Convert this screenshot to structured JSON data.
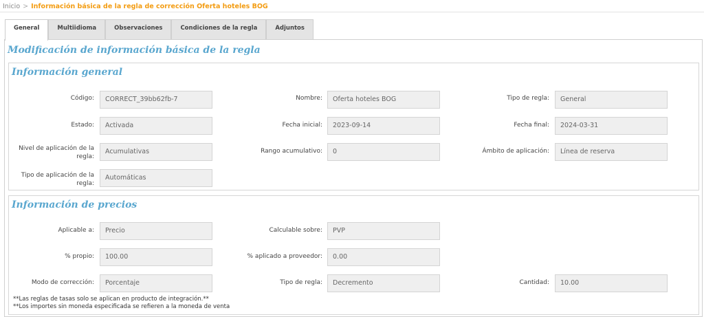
{
  "breadcrumb": {
    "home": "Inicio",
    "separator": ">",
    "current": "Información básica de la regla de corrección Oferta hoteles BOG"
  },
  "tabs": [
    {
      "label": "General",
      "active": true
    },
    {
      "label": "Multiidioma",
      "active": false
    },
    {
      "label": "Observaciones",
      "active": false
    },
    {
      "label": "Condiciones de la regla",
      "active": false
    },
    {
      "label": "Adjuntos",
      "active": false
    }
  ],
  "page_title": "Modificación de información básica de la regla",
  "general": {
    "title": "Información general",
    "codigo": {
      "label": "Código:",
      "value": "CORRECT_39bb62fb-7"
    },
    "nombre": {
      "label": "Nombre:",
      "value": "Oferta hoteles BOG"
    },
    "tipo_regla": {
      "label": "Tipo de regla:",
      "value": "General"
    },
    "estado": {
      "label": "Estado:",
      "value": "Activada"
    },
    "fecha_inicial": {
      "label": "Fecha inicial:",
      "value": "2023-09-14"
    },
    "fecha_final": {
      "label": "Fecha final:",
      "value": "2024-03-31"
    },
    "nivel_aplicacion": {
      "label": "Nivel de aplicación de la regla:",
      "value": "Acumulativas"
    },
    "rango_acumulativo": {
      "label": "Rango acumulativo:",
      "value": "0"
    },
    "ambito_aplicacion": {
      "label": "Ámbito de aplicación:",
      "value": "Línea de reserva"
    },
    "tipo_aplicacion": {
      "label": "Tipo de aplicación de la regla:",
      "value": "Automáticas"
    }
  },
  "precios": {
    "title": "Información de precios",
    "aplicable": {
      "label": "Aplicable a:",
      "value": "Precio"
    },
    "calculable": {
      "label": "Calculable sobre:",
      "value": "PVP"
    },
    "propio": {
      "label": "% propio:",
      "value": "100.00"
    },
    "proveedor": {
      "label": "% aplicado a proveedor:",
      "value": "0.00"
    },
    "modo_correccion": {
      "label": "Modo de corrección:",
      "value": "Porcentaje"
    },
    "tipo_regla": {
      "label": "Tipo de regla:",
      "value": "Decremento"
    },
    "cantidad": {
      "label": "Cantidad:",
      "value": "10.00"
    },
    "notes": [
      "**Las reglas de tasas solo se aplican en producto de integración.**",
      "**Los importes sin moneda especificada se refieren a la moneda de venta"
    ]
  }
}
